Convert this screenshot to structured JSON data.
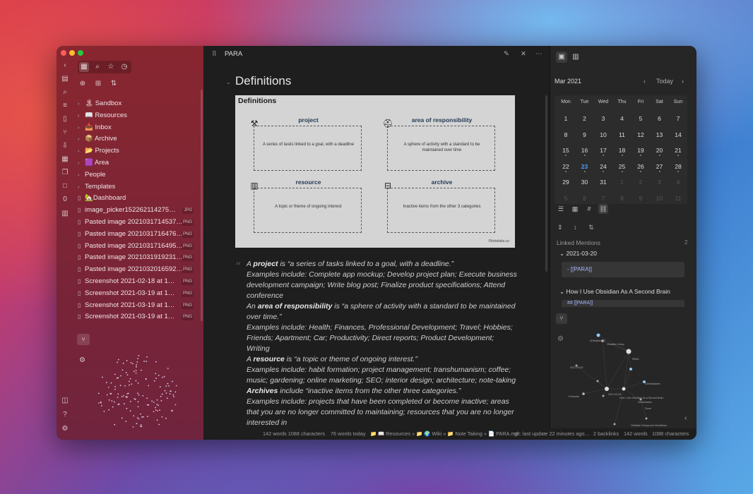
{
  "title": "PARA",
  "sidebar": {
    "tree": [
      {
        "icon": "sandbox-emoji",
        "label": "🏝 Sandbox",
        "type": "folder"
      },
      {
        "icon": "book-emoji",
        "label": "📖 Resources",
        "type": "folder"
      },
      {
        "icon": "inbox-emoji",
        "label": "📥 Inbox",
        "type": "folder"
      },
      {
        "icon": "archive-emoji",
        "label": "📦 Archive",
        "type": "folder"
      },
      {
        "icon": "folder-emoji",
        "label": "📂 Projects",
        "type": "folder"
      },
      {
        "icon": "purple-square-emoji",
        "label": "🟪 Area",
        "type": "folder"
      },
      {
        "label": "People",
        "type": "folder"
      },
      {
        "label": "Templates",
        "type": "folder"
      },
      {
        "label": "🏡Dashboard",
        "type": "file",
        "ext": ""
      },
      {
        "label": "image_picker152262114275…",
        "type": "file",
        "ext": "JPG"
      },
      {
        "label": "Pasted image 2021031714537…",
        "type": "file",
        "ext": "PNG"
      },
      {
        "label": "Pasted image 2021031716476…",
        "type": "file",
        "ext": "PNG"
      },
      {
        "label": "Pasted image 2021031716495…",
        "type": "file",
        "ext": "PNG"
      },
      {
        "label": "Pasted image 2021031919231…",
        "type": "file",
        "ext": "PNG"
      },
      {
        "label": "Pasted image 2021032016592…",
        "type": "file",
        "ext": "PNG"
      },
      {
        "label": "Screenshot 2021-02-18 at 1…",
        "type": "file",
        "ext": "PNG"
      },
      {
        "label": "Screenshot 2021-03-19 at 1…",
        "type": "file",
        "ext": "PNG"
      },
      {
        "label": "Screenshot 2021-03-19 at 1…",
        "type": "file",
        "ext": "PNG"
      },
      {
        "label": "Screenshot 2021-03-19 at 1…",
        "type": "file",
        "ext": "PNG"
      }
    ],
    "rail_zero": "0"
  },
  "editor": {
    "heading": "Definitions",
    "figure": {
      "title": "Definitions",
      "boxes": [
        {
          "title": "project",
          "desc": "A series of tasks linked to a goal, with a deadline",
          "icon": "tools-icon"
        },
        {
          "title": "area of responsibility",
          "desc": "A sphere of activity with a standard to be maintained over time",
          "icon": "hat-icon"
        },
        {
          "title": "resource",
          "desc": "A topic or theme of ongoing interest",
          "icon": "library-icon"
        },
        {
          "title": "archive",
          "desc": "Inactive items from the other 3 categories",
          "icon": "archive-box-icon"
        }
      ],
      "credit": "©fortelabs.co"
    },
    "quote_lines": [
      {
        "pre": "A ",
        "bold": "project",
        "post": " is “a series of tasks linked to a goal, with a deadline.”"
      },
      {
        "pre": "Examples include: Complete app mockup; Develop project plan; Execute business",
        "bold": "",
        "post": ""
      },
      {
        "pre": "development campaign; Write blog post; Finalize product specifications; Attend",
        "bold": "",
        "post": ""
      },
      {
        "pre": "conference",
        "bold": "",
        "post": ""
      },
      {
        "pre": "An ",
        "bold": "area of responsibility",
        "post": " is “a sphere of activity with a standard to be maintained"
      },
      {
        "pre": "over time.”",
        "bold": "",
        "post": ""
      },
      {
        "pre": "Examples include: Health; Finances, Professional Development; Travel; Hobbies;",
        "bold": "",
        "post": ""
      },
      {
        "pre": "Friends; Apartment; Car; Productivity; Direct reports; Product Development;",
        "bold": "",
        "post": ""
      },
      {
        "pre": "Writing",
        "bold": "",
        "post": ""
      },
      {
        "pre": "A ",
        "bold": "resource",
        "post": " is “a topic or theme of ongoing interest.”"
      },
      {
        "pre": "Examples include: habit formation; project management; transhumanism; coffee;",
        "bold": "",
        "post": ""
      },
      {
        "pre": "music; gardening; online marketing; SEO; interior design; architecture; note-taking",
        "bold": "",
        "post": ""
      },
      {
        "pre": "",
        "bold": "Archives",
        "post": " include “inactive items from the other three categories.”"
      },
      {
        "pre": "Examples include: projects that have been completed or become inactive; areas",
        "bold": "",
        "post": ""
      },
      {
        "pre": "that you are no longer committed to maintaining; resources that you are no longer",
        "bold": "",
        "post": ""
      },
      {
        "pre": "interested in",
        "bold": "",
        "post": ""
      }
    ]
  },
  "calendar": {
    "month": "Mar 2021",
    "today_label": "Today",
    "weekdays": [
      "Mon",
      "Tue",
      "Wed",
      "Thu",
      "Fri",
      "Sat",
      "Sun"
    ],
    "weeks": [
      [
        "1",
        "2",
        "3",
        "4",
        "5",
        "6",
        "7"
      ],
      [
        "8",
        "9",
        "10",
        "11",
        "12",
        "13",
        "14"
      ],
      [
        "15",
        "16",
        "17",
        "18",
        "19",
        "20",
        "21"
      ],
      [
        "22",
        "23",
        "24",
        "25",
        "26",
        "27",
        "28"
      ],
      [
        "29",
        "30",
        "31",
        "1",
        "2",
        "3",
        "4"
      ],
      [
        "5",
        "6",
        "7",
        "8",
        "9",
        "10",
        "11"
      ]
    ],
    "today": "23",
    "accent": "#4d9fff"
  },
  "linked": {
    "title": "Linked Mentions",
    "count": "2",
    "items": [
      {
        "title": "2021-03-20",
        "snippet": "- [[PARA]]"
      },
      {
        "title": "How I Use Obsidian As A Second Brain",
        "snippet": "## [[PARA]]"
      }
    ]
  },
  "graph_labels": [
    "#ObsidianMD",
    "Obsidian Setup",
    "PARA",
    "2021-03-20",
    "#Zettelkasten",
    "#Youtube",
    "2021-03-23",
    "How I Use Obsidian As a Second Brain",
    "Zettelkasten",
    "Zoom",
    "Obsidian Setups and Workflows"
  ],
  "status": {
    "left_words": "142 words 1088 characters",
    "today": "76 words today",
    "path": "📁 📖 Resources » 📁 🌍 Wiki » 📁 Note Taking » 📄 PARA.md",
    "git": "git: last update 22 minutes ago…",
    "backlinks": "2 backlinks",
    "words": "142 words",
    "chars": "1088 characters"
  }
}
